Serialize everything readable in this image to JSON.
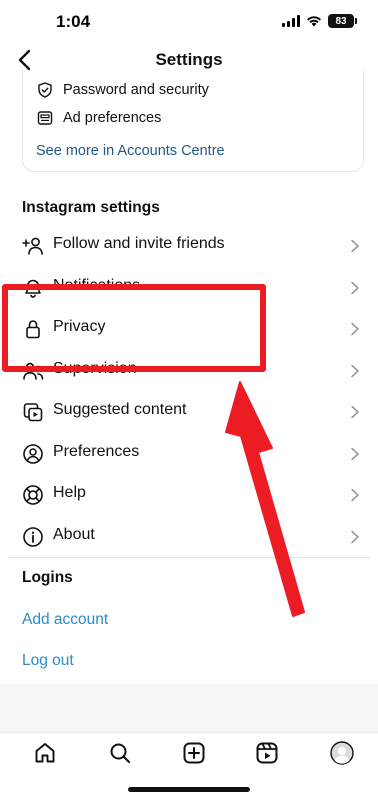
{
  "status_bar": {
    "time": "1:04",
    "battery": "83"
  },
  "header": {
    "title": "Settings"
  },
  "accounts_centre": {
    "items": [
      {
        "label": "Password and security",
        "icon": "shield-check-icon"
      },
      {
        "label": "Ad preferences",
        "icon": "ad-icon"
      }
    ],
    "link": "See more in Accounts Centre"
  },
  "instagram_settings": {
    "title": "Instagram settings",
    "items": [
      {
        "label": "Follow and invite friends",
        "icon": "add-person-icon"
      },
      {
        "label": "Notifications",
        "icon": "bell-icon"
      },
      {
        "label": "Privacy",
        "icon": "lock-icon"
      },
      {
        "label": "Supervision",
        "icon": "supervision-icon"
      },
      {
        "label": "Suggested content",
        "icon": "suggested-content-icon"
      },
      {
        "label": "Preferences",
        "icon": "preferences-icon"
      },
      {
        "label": "Help",
        "icon": "help-icon"
      },
      {
        "label": "About",
        "icon": "info-icon"
      }
    ]
  },
  "logins": {
    "title": "Logins",
    "add_account": "Add account",
    "log_out": "Log out"
  },
  "bottom_nav": {
    "items": [
      "home-icon",
      "search-icon",
      "create-icon",
      "reels-icon",
      "profile-avatar"
    ]
  },
  "colors": {
    "link": "#2a8bc3",
    "accounts_link": "#1e5a8c",
    "annotation": "#ec1c24"
  }
}
